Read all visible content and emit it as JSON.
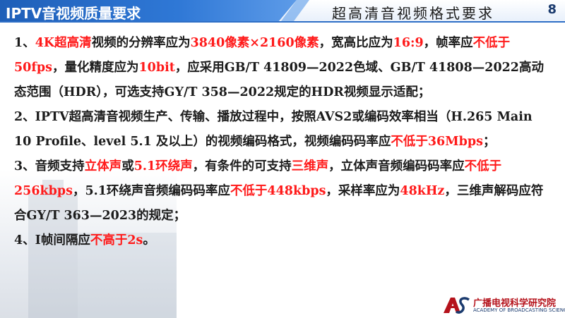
{
  "header": {
    "title": "IPTV音视频质量要求",
    "subtitle": "超高清音视频格式要求",
    "page_number": "8"
  },
  "colors": {
    "accent": "#ff1a1a",
    "header_blue": "#1f5fb8",
    "text": "#1c1c1c"
  },
  "content": {
    "paragraphs": [
      [
        {
          "t": "1、",
          "red": false
        },
        {
          "t": "4K超高清",
          "red": true
        },
        {
          "t": "视频的分辨率应为",
          "red": false
        },
        {
          "t": "3840像素×2160像素",
          "red": true
        },
        {
          "t": "，宽高比应为",
          "red": false
        },
        {
          "t": "16:9",
          "red": true
        },
        {
          "t": "，帧率应",
          "red": false
        },
        {
          "t": "不低于50fps",
          "red": true
        },
        {
          "t": "，量化精度应为",
          "red": false
        },
        {
          "t": "10bit",
          "red": true
        },
        {
          "t": "，应采用GB/T 41809—2022色域、GB/T 41808—2022高动态范围（HDR），可选支持GY/T 358—2022规定的HDR视频显示适配；",
          "red": false
        }
      ],
      [
        {
          "t": "2、IPTV超高清音视频生产、传输、播放过程中，按照AVS2或编码效率相当（H.265 Main 10 Profile、level 5.1 及以上）的视频编码格式，视频编码码率应",
          "red": false
        },
        {
          "t": "不低于36Mbps",
          "red": true
        },
        {
          "t": "；",
          "red": false
        }
      ],
      [
        {
          "t": "3、音频支持",
          "red": false
        },
        {
          "t": "立体声",
          "red": true
        },
        {
          "t": "或",
          "red": false
        },
        {
          "t": "5.1环绕声",
          "red": true
        },
        {
          "t": "，有条件的可支持",
          "red": false
        },
        {
          "t": "三维声",
          "red": true
        },
        {
          "t": "，立体声音频编码码率应",
          "red": false
        },
        {
          "t": "不低于256kbps",
          "red": true
        },
        {
          "t": "，5.1环绕声音频编码码率应",
          "red": false
        },
        {
          "t": "不低于448kbps",
          "red": true
        },
        {
          "t": "，采样率应为",
          "red": false
        },
        {
          "t": "48kHz",
          "red": true
        },
        {
          "t": "，三维声解码应符合GY/T 363—2023的规定；",
          "red": false
        }
      ],
      [
        {
          "t": "4、I帧间隔应",
          "red": false
        },
        {
          "t": "不高于2s",
          "red": true
        },
        {
          "t": "。",
          "red": false
        }
      ]
    ]
  },
  "logo": {
    "name": "广播电视科学研究院",
    "english": "ACADEMY OF BROADCASTING SCIENCE",
    "mark_text": "AS"
  }
}
